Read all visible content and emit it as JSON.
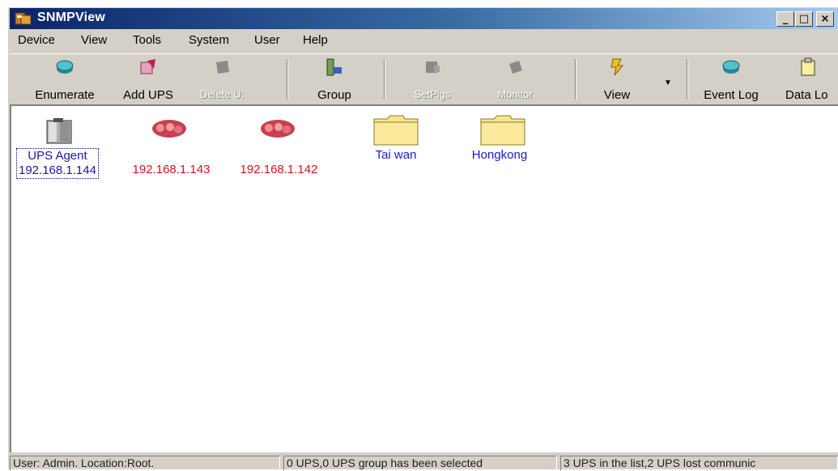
{
  "window": {
    "title": "SNMPView"
  },
  "menu": [
    {
      "label": "Device"
    },
    {
      "label": "View"
    },
    {
      "label": "Tools"
    },
    {
      "label": "System"
    },
    {
      "label": "User"
    },
    {
      "label": "Help"
    }
  ],
  "toolbar": [
    {
      "label": "Enumerate",
      "icon": "enumerate-icon",
      "enabled": true
    },
    {
      "label": "Add UPS",
      "icon": "add-ups-icon",
      "enabled": true
    },
    {
      "label": "Delete U:",
      "icon": "delete-ups-icon",
      "enabled": false
    },
    {
      "label": "Group",
      "icon": "group-icon",
      "enabled": true
    },
    {
      "label": "SetPigs",
      "icon": "settings-icon",
      "enabled": false
    },
    {
      "label": "Monitor",
      "icon": "monitor-icon",
      "enabled": false
    },
    {
      "label": "View",
      "icon": "view-icon",
      "enabled": true
    },
    {
      "label": "Event Log",
      "icon": "event-log-icon",
      "enabled": true
    },
    {
      "label": "Data Lo",
      "icon": "data-log-icon",
      "enabled": true
    }
  ],
  "items": [
    {
      "line1": "UPS Agent",
      "line2": "192.168.1.144",
      "type": "agent"
    },
    {
      "label": "192.168.1.143",
      "type": "ups-lost",
      "color": "#e01020"
    },
    {
      "label": "192.168.1.142",
      "type": "ups-lost",
      "color": "#e01020"
    },
    {
      "label": "Tai wan",
      "type": "group-folder",
      "color": "#1a1ac8"
    },
    {
      "label": "Hongkong",
      "type": "group-folder",
      "color": "#1a1ac8"
    }
  ],
  "status": {
    "user": "User: Admin.  Location:Root.",
    "selection": "0 UPS,0 UPS group has been selected",
    "summary": "3 UPS in the list,2 UPS  lost communic"
  }
}
